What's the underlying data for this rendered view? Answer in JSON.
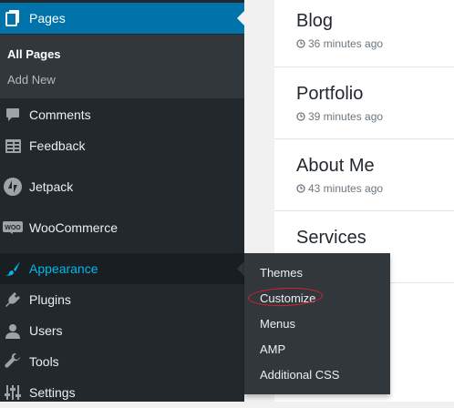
{
  "sidebar": {
    "pages": {
      "label": "Pages",
      "icon": "pages-icon"
    },
    "pages_submenu": [
      "All Pages",
      "Add New"
    ],
    "items": [
      {
        "label": "Comments",
        "icon": "comment-icon"
      },
      {
        "label": "Feedback",
        "icon": "feedback-icon"
      },
      {
        "label": "Jetpack",
        "icon": "jetpack-icon"
      },
      {
        "label": "WooCommerce",
        "icon": "woocommerce-icon"
      },
      {
        "label": "Appearance",
        "icon": "paintbrush-icon"
      },
      {
        "label": "Plugins",
        "icon": "plugin-icon"
      },
      {
        "label": "Users",
        "icon": "user-icon"
      },
      {
        "label": "Tools",
        "icon": "wrench-icon"
      },
      {
        "label": "Settings",
        "icon": "settings-icon"
      }
    ]
  },
  "appearance_flyout": {
    "items": [
      "Themes",
      "Customize",
      "Menus",
      "AMP",
      "Additional CSS"
    ]
  },
  "posts": [
    {
      "title": "Blog",
      "time": "36 minutes ago"
    },
    {
      "title": "Portfolio",
      "time": "39 minutes ago"
    },
    {
      "title": "About Me",
      "time": "43 minutes ago"
    },
    {
      "title": "Services"
    }
  ],
  "colors": {
    "admin_bar": "#23282d",
    "current": "#0073aa",
    "highlight": "#00b9eb",
    "annotation": "#d9232d"
  }
}
